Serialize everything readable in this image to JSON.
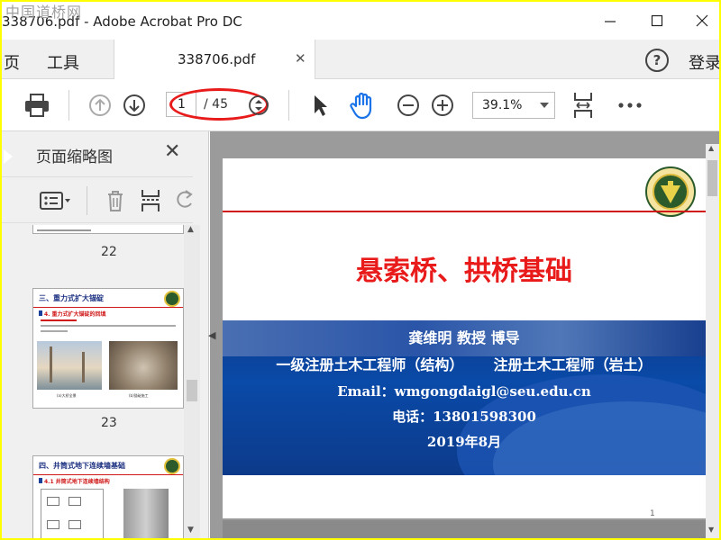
{
  "titlebar": {
    "watermark": "中国道桥网",
    "title": "338706.pdf - Adobe Acrobat Pro DC"
  },
  "tabbar": {
    "home_label": "页",
    "tools_label": "工具",
    "doc_tab_label": "338706.pdf",
    "help_label": "?",
    "login_label": "登录"
  },
  "toolbar": {
    "current_page": "1",
    "page_total": "/ 45",
    "zoom": "39.1%",
    "icons": [
      "print-icon",
      "page-up-icon",
      "page-down-icon",
      "page-stepper-icon",
      "select-arrow-icon",
      "hand-icon",
      "zoom-out-icon",
      "zoom-in-icon",
      "fit-page-icon",
      "more-icon"
    ],
    "accent": "#1a73e8",
    "annotation_color": "#e81a1a"
  },
  "sidebar": {
    "title": "页面缩略图",
    "thumbnails": [
      {
        "number": "22",
        "heading": ""
      },
      {
        "number": "23",
        "heading": "三、重力式扩大锚碇",
        "subheading": "4. 重力式扩大锚碇的回填",
        "caption_left": "(a)大桥全景",
        "caption_right": "(b)锚碇施工"
      },
      {
        "number": "",
        "heading": "四、井筒式地下连续墙基础",
        "subheading": "4.1 井筒式地下连续墙结构"
      }
    ]
  },
  "slide": {
    "title": "悬索桥、拱桥基础",
    "author": "龚维明 教授 博导",
    "qualification_left": "一级注册土木工程师（结构）",
    "qualification_right": "注册土木工程师（岩土）",
    "email": "Email：wmgongdaigl@seu.edu.cn",
    "phone": "电话：13801598300",
    "date": "2019年8月",
    "page_number": "1",
    "colors": {
      "title": "#e81a1a",
      "band": "#0c3c8e",
      "rule": "#d01818"
    }
  }
}
